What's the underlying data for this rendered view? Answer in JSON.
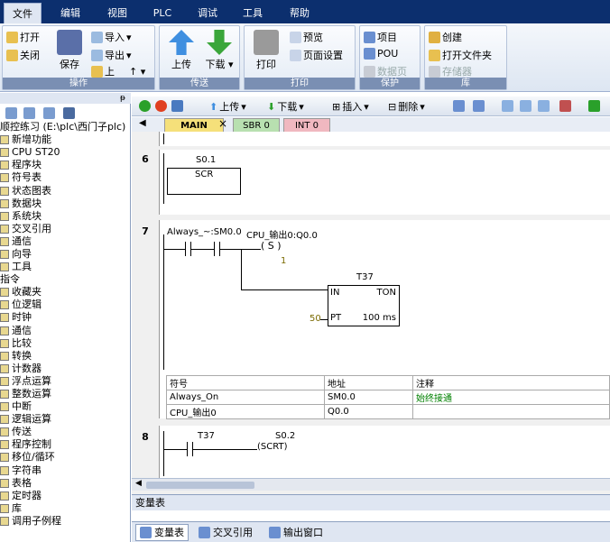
{
  "menu_tabs": [
    "文件",
    "编辑",
    "视图",
    "PLC",
    "调试",
    "工具",
    "帮助"
  ],
  "ribbon": {
    "groups": [
      "操作",
      "传送",
      "打印",
      "保护",
      "库"
    ],
    "buttons": {
      "open": "打开",
      "close": "关闭",
      "save": "保存",
      "import": "导入",
      "export": "导出",
      "up": "上",
      "upload": "上传",
      "download": "下载",
      "print": "打印",
      "preview": "预览",
      "page_setup": "页面设置",
      "project": "项目",
      "pou": "POU",
      "data_page": "数据页",
      "create": "创建",
      "open_folder": "打开文件夹",
      "memory": "存储器"
    }
  },
  "tree": {
    "project_label": "顺控练习 (E:\\plc\\西门子plc)",
    "project_items": [
      "新增功能",
      "CPU ST20",
      "程序块",
      "符号表",
      "状态图表",
      "数据块",
      "系统块",
      "交叉引用",
      "通信",
      "向导",
      "工具"
    ],
    "instructions_label": "指令",
    "instruction_items": [
      "收藏夹",
      "位逻辑",
      "时钟",
      "通信",
      "比较",
      "转换",
      "计数器",
      "浮点运算",
      "整数运算",
      "中断",
      "逻辑运算",
      "传送",
      "程序控制",
      "移位/循环",
      "字符串",
      "表格",
      "定时器",
      "库",
      "调用子例程"
    ]
  },
  "editor_toolbar": {
    "upload": "上传",
    "download": "下载",
    "insert": "插入",
    "delete": "删除"
  },
  "program_tabs": [
    "MAIN",
    "SBR 0",
    "INT 0"
  ],
  "networks": [
    {
      "num": "6",
      "contact": "S0.1",
      "box": "SCR"
    },
    {
      "num": "7",
      "contact1": "Always_~:SM0.0",
      "coil_label": "CPU_输出0:Q0.0",
      "coil": "S",
      "coil_n": "1",
      "timer": "T37",
      "timer_in": "IN",
      "timer_type": "TON",
      "timer_pt": "PT",
      "timer_pt_val": "50",
      "timer_base": "100 ms"
    },
    {
      "num": "8",
      "contact": "T37",
      "coil_label": "S0.2",
      "coil": "SCRT"
    }
  ],
  "symbol_table": {
    "headers": [
      "符号",
      "地址",
      "注释"
    ],
    "rows": [
      [
        "Always_On",
        "SM0.0",
        "始终接通"
      ],
      [
        "CPU_输出0",
        "Q0.0",
        ""
      ]
    ]
  },
  "var_table_label": "变量表",
  "bottom_tabs": [
    "变量表",
    "交叉引用",
    "输出窗口"
  ],
  "colors": {
    "title_bar": "#0c2f6e",
    "main_tab": "#f5e07a",
    "sbr_tab": "#b8e0b0",
    "int_tab": "#f0b8c0",
    "comment": "#008000"
  }
}
